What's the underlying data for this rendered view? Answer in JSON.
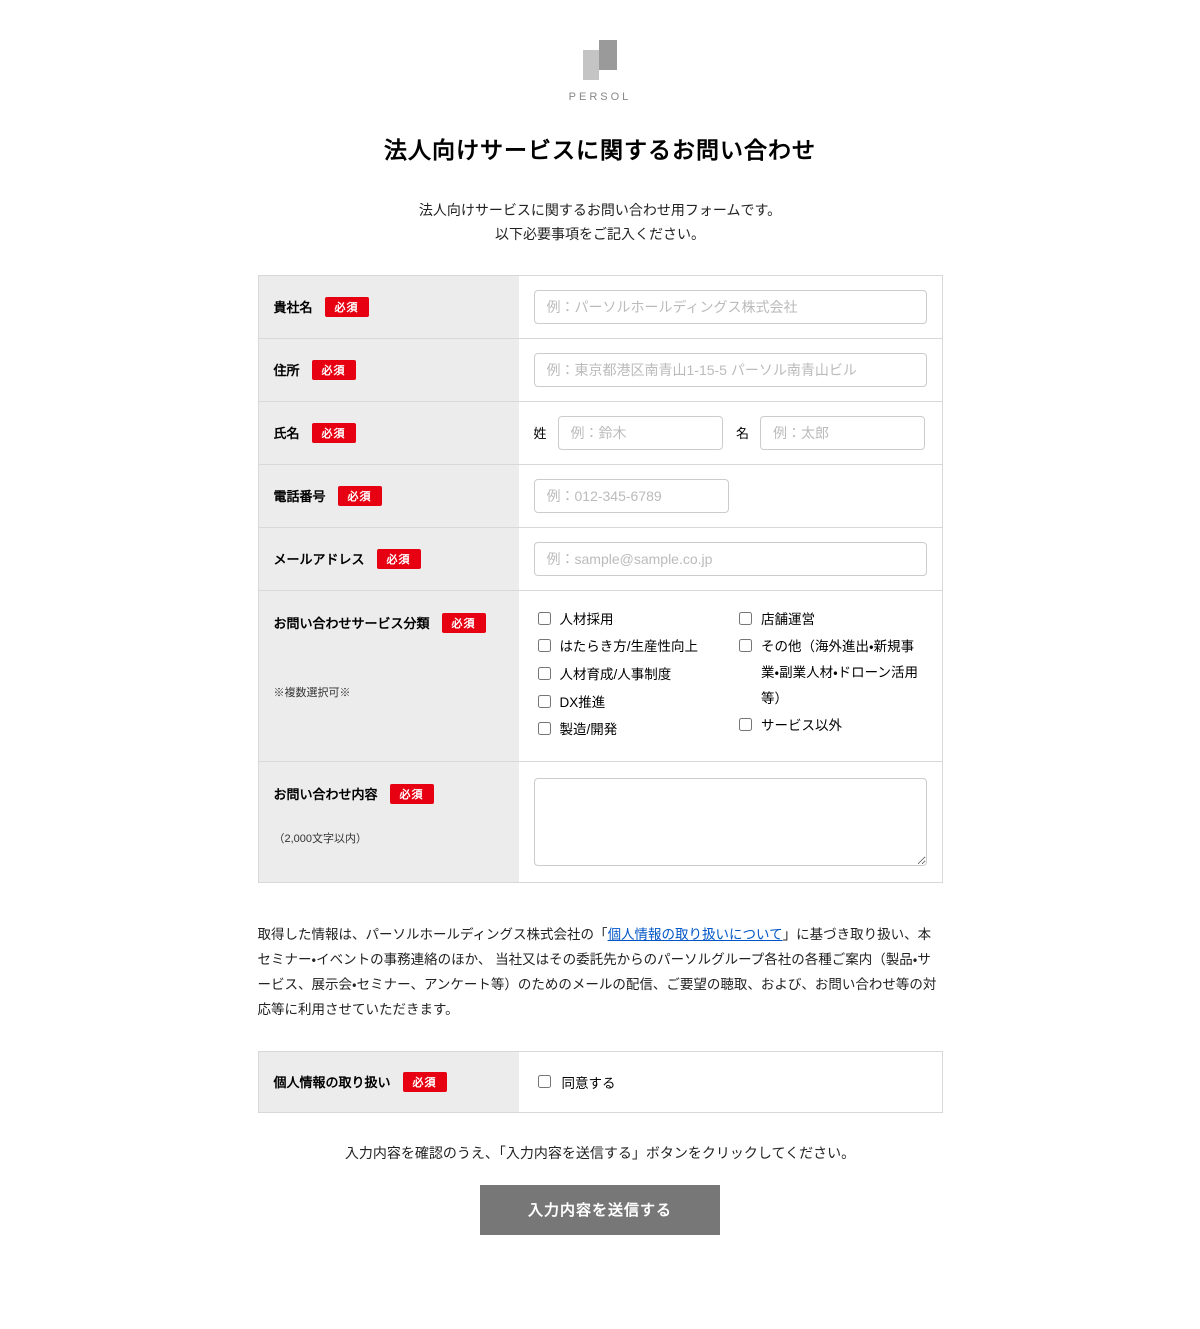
{
  "logo": {
    "brand_text": "PERSOL"
  },
  "title": "法人向けサービスに関するお問い合わせ",
  "intro_line1": "法人向けサービスに関するお問い合わせ用フォームです。",
  "intro_line2": "以下必要事項をご記入ください。",
  "required_badge": "必須",
  "fields": {
    "company": {
      "label": "貴社名",
      "placeholder": "例：パーソルホールディングス株式会社"
    },
    "address": {
      "label": "住所",
      "placeholder": "例：東京都港区南青山1-15-5 パーソル南青山ビル"
    },
    "name": {
      "label": "氏名",
      "last_prefix": "姓",
      "first_prefix": "名",
      "last_placeholder": "例：鈴木",
      "first_placeholder": "例：太郎"
    },
    "phone": {
      "label": "電話番号",
      "placeholder": "例：012-345-6789"
    },
    "email": {
      "label": "メールアドレス",
      "placeholder": "例：sample@sample.co.jp"
    },
    "category": {
      "label": "お問い合わせサービス分類",
      "sub": "※複数選択可※",
      "left": [
        "人材採用",
        "はたらき方/生産性向上",
        "人材育成/人事制度",
        "DX推進",
        "製造/開発"
      ],
      "right": [
        "店舗運営",
        "その他（海外進出・新規事業・副業人材・ドローン活用等）",
        "サービス以外"
      ]
    },
    "details": {
      "label": "お問い合わせ内容",
      "sub": "（2,000文字以内）"
    }
  },
  "privacy": {
    "before_link": "取得した情報は、パーソルホールディングス株式会社の「",
    "link_text": "個人情報の取り扱いについて",
    "after_link": "」に基づき取り扱い、本セミナー・イベントの事務連絡のほか、 当社又はその委託先からのパーソルグループ各社の各種ご案内（製品・サービス、展示会・セミナー、アンケート等）のためのメールの配信、ご要望の聴取、および、お問い合わせ等の対応等に利用させていただきます。"
  },
  "consent": {
    "label": "個人情報の取り扱い",
    "agree_text": "同意する"
  },
  "submit_note": "入力内容を確認のうえ、「入力内容を送信する」ボタンをクリックしてください。",
  "submit_button": "入力内容を送信する"
}
